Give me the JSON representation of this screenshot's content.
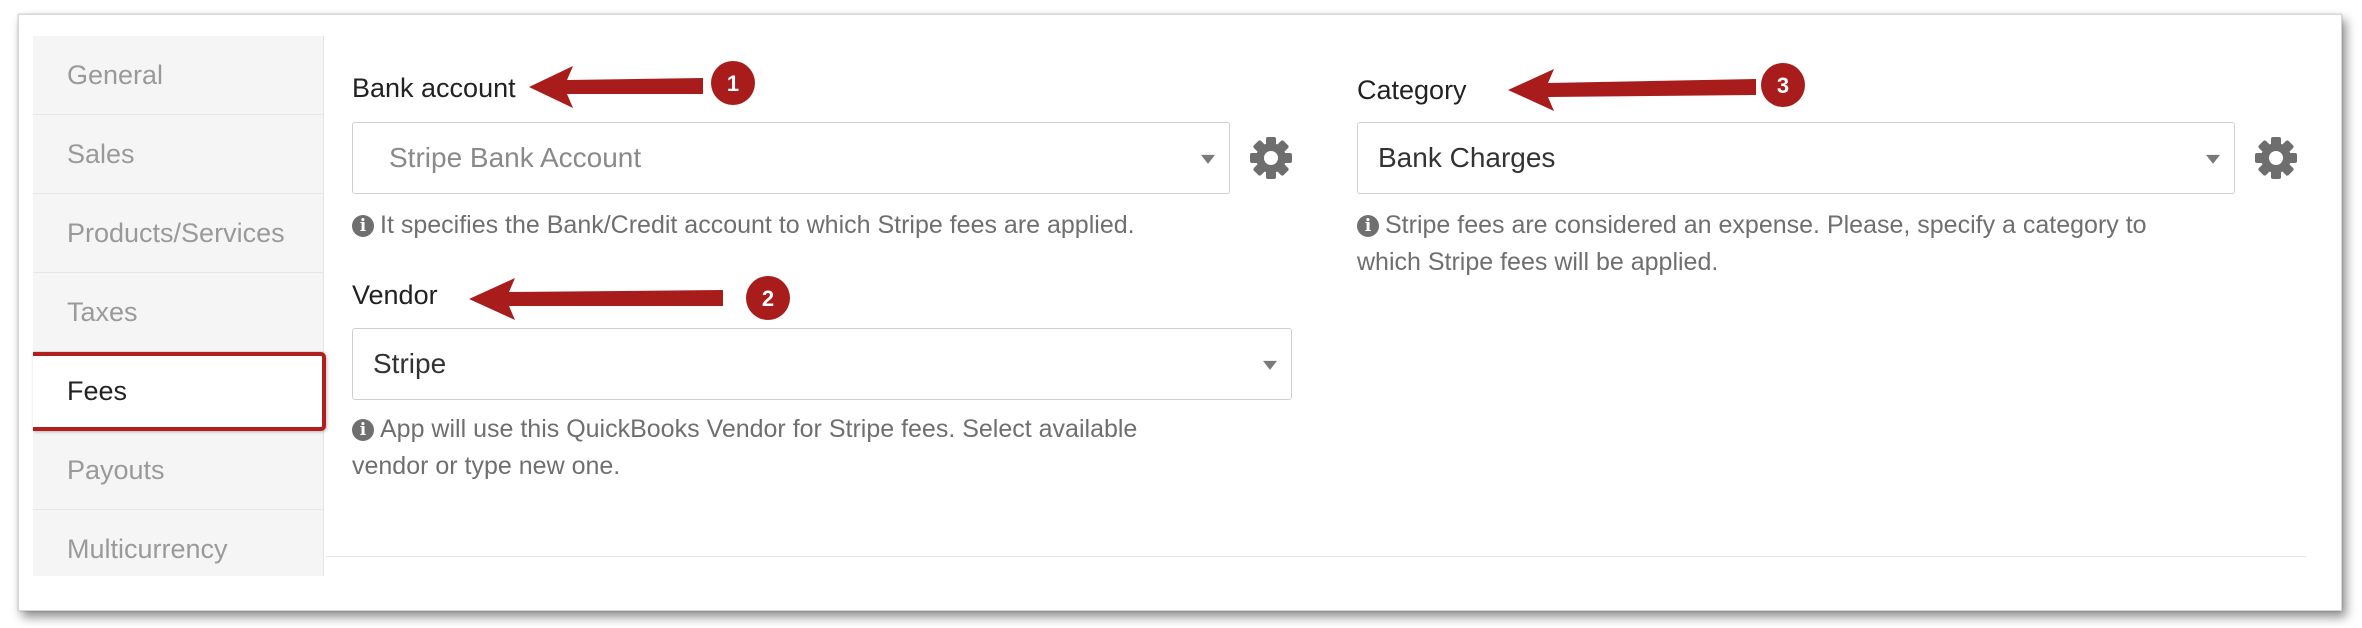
{
  "sidebar": {
    "items": [
      {
        "label": "General"
      },
      {
        "label": "Sales"
      },
      {
        "label": "Products/Services"
      },
      {
        "label": "Taxes"
      },
      {
        "label": "Fees"
      },
      {
        "label": "Payouts"
      },
      {
        "label": "Multicurrency"
      }
    ],
    "active": "Fees"
  },
  "bank_account": {
    "label": "Bank account",
    "selected": "Stripe Bank Account",
    "help": "It specifies the Bank/Credit account to which Stripe fees are applied.",
    "callout": "1"
  },
  "vendor": {
    "label": "Vendor",
    "selected": "Stripe",
    "help_line1": "App will use this QuickBooks Vendor for Stripe fees. Select available",
    "help_line2": "vendor or type new one.",
    "callout": "2"
  },
  "category": {
    "label": "Category",
    "selected": "Bank Charges",
    "help_line1": "Stripe fees are considered an expense. Please, specify a category to",
    "help_line2": "which Stripe fees will be applied.",
    "callout": "3"
  },
  "colors": {
    "annotation_red": "#b01e1e",
    "gear_gray": "#6e6e6e"
  },
  "icons": [
    "gear-icon",
    "info-icon",
    "chevron-down-icon",
    "arrow-annotation-icon"
  ]
}
